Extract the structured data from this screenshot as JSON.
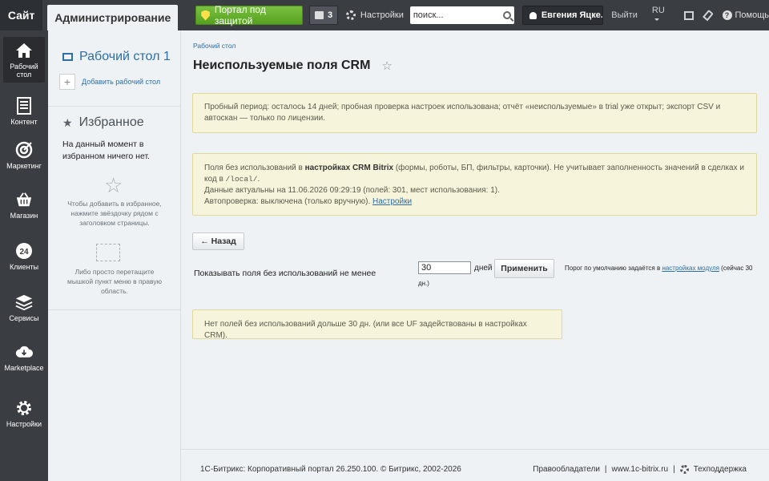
{
  "topbar": {
    "site_tab": "Сайт",
    "admin_tab": "Администрирование",
    "portal_button": "Портал под защитой",
    "notifications_count": "3",
    "settings_label": "Настройки",
    "search_placeholder": "поиск...",
    "user_name": "Евгения Яцке...",
    "logout": "Выйти",
    "lang": "RU",
    "help": "Помощь"
  },
  "nav": {
    "items": [
      {
        "label": "Рабочий стол",
        "icon": "home-icon"
      },
      {
        "label": "Контент",
        "icon": "document-icon"
      },
      {
        "label": "Маркетинг",
        "icon": "target-icon"
      },
      {
        "label": "Магазин",
        "icon": "basket-icon"
      },
      {
        "label": "Клиенты",
        "icon": "clients-24-icon"
      },
      {
        "label": "Сервисы",
        "icon": "layers-icon"
      },
      {
        "label": "Marketplace",
        "icon": "cloud-download-icon"
      },
      {
        "label": "Настройки",
        "icon": "gear-icon"
      }
    ],
    "clients_badge": "24"
  },
  "panel": {
    "desktop_title": "Рабочий стол 1",
    "add_desktop": "Добавить рабочий стол",
    "favorites_title": "Избранное",
    "favorites_empty": "На данный момент в избранном ничего нет.",
    "favorites_hint_star": "Чтобы добавить в избранное, нажмите звёздочку рядом с заголовком страницы.",
    "favorites_hint_drag": "Либо просто перетащите мышкой пункт меню в правую область."
  },
  "main": {
    "breadcrumb": "Рабочий стол",
    "title": "Неиспользуемые поля CRM",
    "trial_note": "Пробный период: осталось 14 дней; пробная проверка настроек использована; отчёт «неиспользуемые» в trial уже открыт; экспорт CSV и автоскан — только по лицензии.",
    "info": {
      "line1_prefix": "Поля без использований в ",
      "line1_bold": "настройках CRM Bitrix",
      "line1_suffix": " (формы, роботы, БП, фильтры, карточки). Не учитывает заполненность значений в сделках и",
      "line2_prefix": "код в ",
      "line2_code": "/local/",
      "line2_suffix": ".",
      "line3": "Данные актуальны на 11.06.2026 09:29:19 (полей: 301, мест использования: 1).",
      "line4_prefix": "Автопроверка: выключена (только вручную). ",
      "line4_link": "Настройки"
    },
    "back_button": "← Назад",
    "filter_label": "Показывать поля без использований не менее",
    "days_value": "30",
    "days_unit": "дней",
    "apply_button": "Применить",
    "hint_prefix": "Порог по умолчанию задаётся в ",
    "hint_link": "настройках модуля",
    "hint_suffix": " (сейчас 30",
    "hint_line2": "дн.)",
    "result_note": "Нет полей без использований дольше 30 дн. (или все UF задействованы в настройках CRM)."
  },
  "footer": {
    "copyright": "1С-Битрикс: Корпоративный портал 26.250.100. © Битрикс, 2002-2026",
    "rights": "Правообладатели",
    "site": "www.1c-bitrix.ru",
    "support": "Техподдержка"
  }
}
